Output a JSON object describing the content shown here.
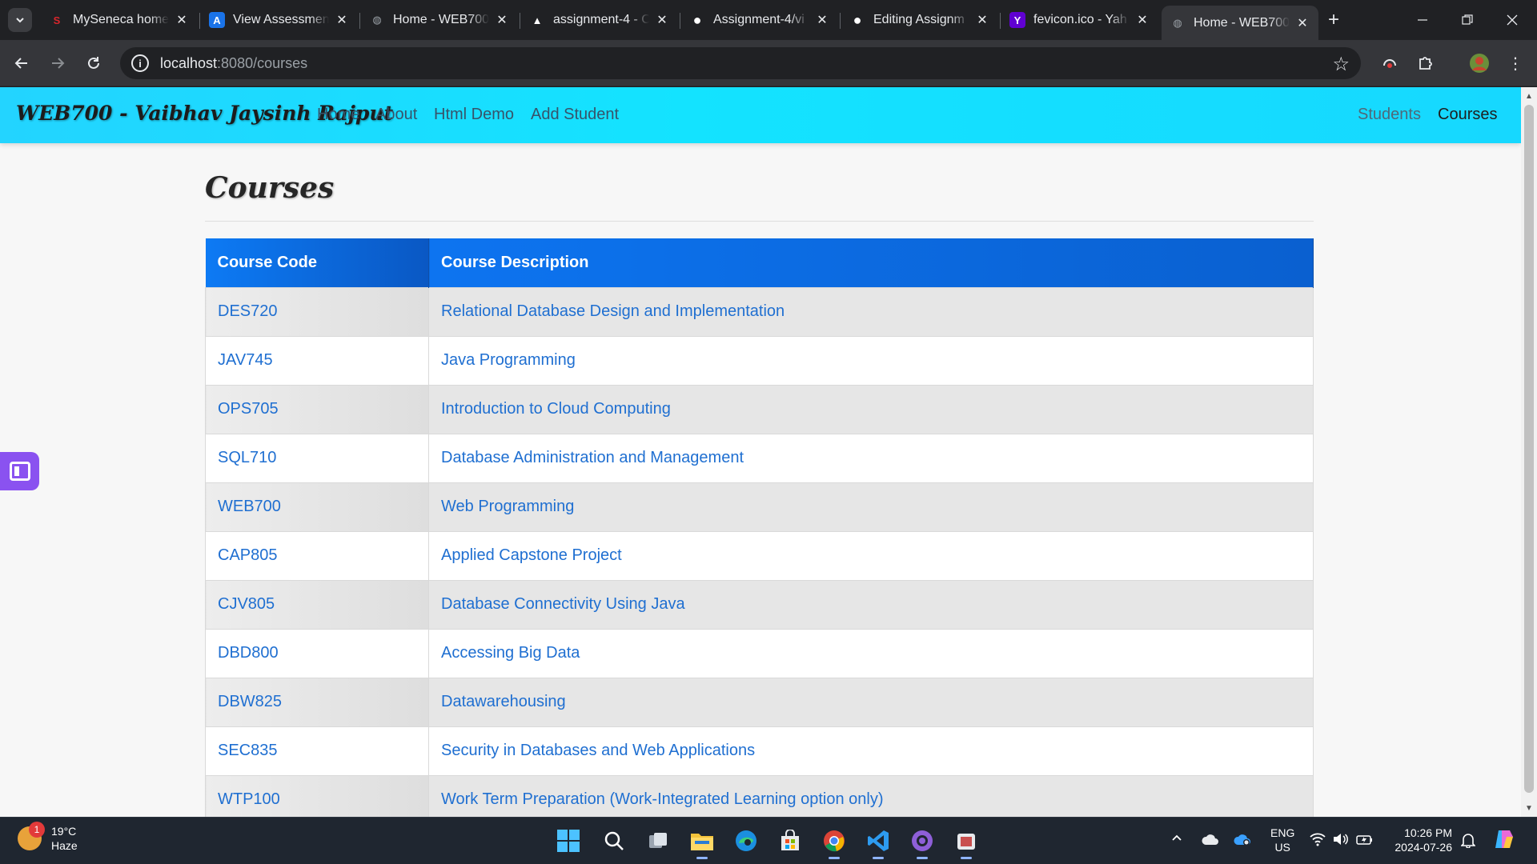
{
  "browser": {
    "tabs": [
      {
        "title": "MySeneca home",
        "favicon": "seneca-s",
        "color": "#d8262c"
      },
      {
        "title": "View Assessment",
        "favicon": "assessment-a",
        "color": "#1a73e8"
      },
      {
        "title": "Home - WEB700",
        "favicon": "globe",
        "color": "#9aa0a6"
      },
      {
        "title": "assignment-4 - C",
        "favicon": "triangle",
        "color": "#ffffff"
      },
      {
        "title": "Assignment-4/vi",
        "favicon": "github",
        "color": "#ffffff"
      },
      {
        "title": "Editing Assignm",
        "favicon": "github",
        "color": "#ffffff"
      },
      {
        "title": "fevicon.ico - Yah",
        "favicon": "yahoo-y",
        "color": "#6001d2"
      },
      {
        "title": "Home - WEB700",
        "favicon": "globe",
        "color": "#9aa0a6",
        "active": true
      }
    ],
    "address": {
      "host": "localhost",
      "rest": ":8080/courses"
    }
  },
  "site": {
    "brand": "WEB700 - Vaibhav Jaysinh Rajput",
    "nav_left": [
      "Home",
      "About",
      "Html Demo",
      "Add Student"
    ],
    "nav_right": [
      "Students",
      "Courses"
    ],
    "active_link": "Courses",
    "accent": "#13e3ff"
  },
  "page": {
    "title": "Courses"
  },
  "table": {
    "headers": [
      "Course Code",
      "Course Description"
    ],
    "header_color": "#0d74f0",
    "link_color": "#1f6fd1",
    "rows": [
      {
        "code": "DES720",
        "description": "Relational Database Design and Implementation"
      },
      {
        "code": "JAV745",
        "description": "Java Programming"
      },
      {
        "code": "OPS705",
        "description": "Introduction to Cloud Computing"
      },
      {
        "code": "SQL710",
        "description": "Database Administration and Management"
      },
      {
        "code": "WEB700",
        "description": "Web Programming"
      },
      {
        "code": "CAP805",
        "description": "Applied Capstone Project"
      },
      {
        "code": "CJV805",
        "description": "Database Connectivity Using Java"
      },
      {
        "code": "DBD800",
        "description": "Accessing Big Data"
      },
      {
        "code": "DBW825",
        "description": "Datawarehousing"
      },
      {
        "code": "SEC835",
        "description": "Security in Databases and Web Applications"
      },
      {
        "code": "WTP100",
        "description": "Work Term Preparation (Work-Integrated Learning option only)"
      }
    ]
  },
  "taskbar": {
    "weather": {
      "temp": "19°C",
      "condition": "Haze",
      "badge": "1"
    },
    "language": {
      "line1": "ENG",
      "line2": "US"
    },
    "clock": {
      "time": "10:26 PM",
      "date": "2024-07-26"
    }
  }
}
